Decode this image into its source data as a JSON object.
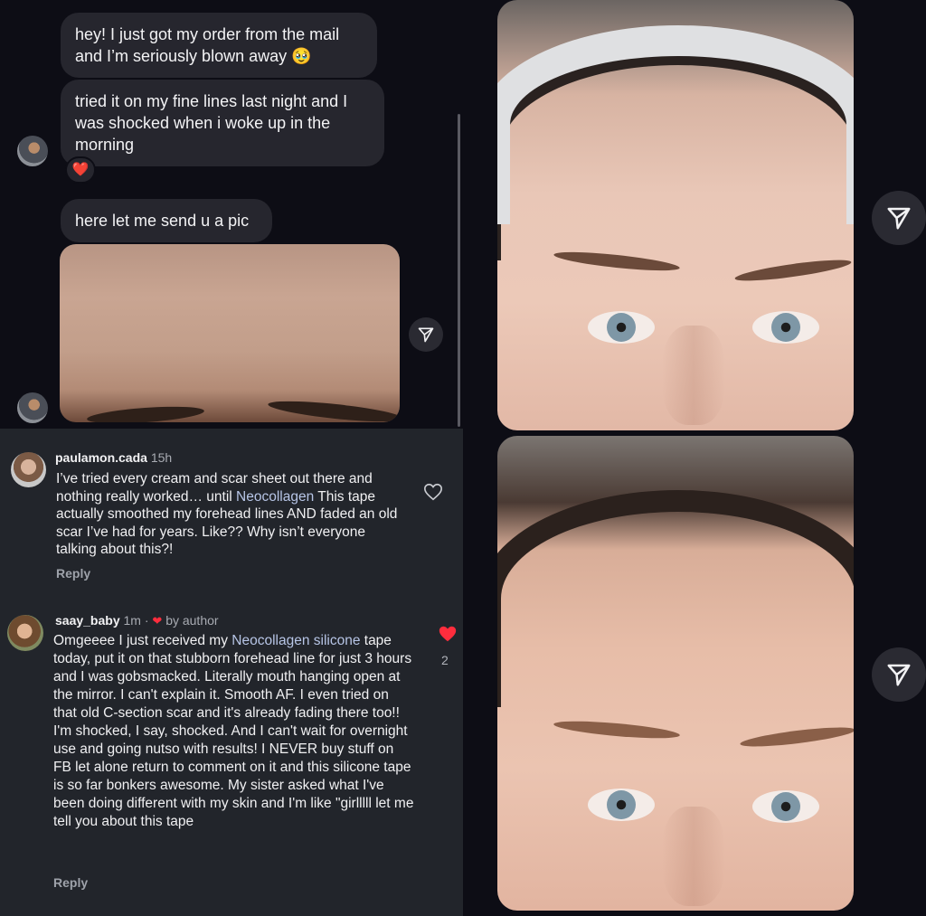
{
  "chat": {
    "messages": [
      {
        "text": "hey! I just got my order from the mail\nand  I’m seriously blown away 🥹"
      },
      {
        "text": "tried it on my fine lines last night and I\nwas shocked when i woke up in the\nmorning"
      },
      {
        "text": "here let me send u a pic"
      }
    ],
    "reaction": "❤️"
  },
  "comments": [
    {
      "username": "paulamon.cada",
      "time": "15h",
      "byline": "",
      "body_before": "I’ve tried every cream and scar sheet out there and nothing really worked… until ",
      "body_link": "Neocollagen",
      "body_after": " This tape actually smoothed my forehead lines AND faded an old scar I’ve had for years. Like?? Why isn’t everyone talking about this?!",
      "reply_label": "Reply",
      "likes": ""
    },
    {
      "username": "saay_baby",
      "time": "1m ·",
      "byline": "by author",
      "body_before": "Omgeeee I just received my ",
      "body_link": "Neocollagen silicone",
      "body_after": " tape today, put it on that stubborn forehead line for just 3 hours and I was gobsmacked. Literally mouth hanging open at the mirror. I can't explain it. Smooth AF. I even tried on that old C-section scar and it's already fading there too!! I'm shocked, I say, shocked. And I can't wait for overnight use and going nutso with results! I NEVER buy stuff on FB let alone return to comment on it and this silicone tape is so far bonkers awesome. My sister asked what I've been doing different with my skin and I'm like \"girlllll let me tell you about this tape",
      "reply_label": "Reply",
      "likes": "2"
    }
  ],
  "icons": {
    "share": "paper-plane-icon",
    "like": "heart-icon"
  },
  "colors": {
    "like_active": "#ff2d3d",
    "link": "#b7c5e6",
    "bubble": "#26262e"
  }
}
